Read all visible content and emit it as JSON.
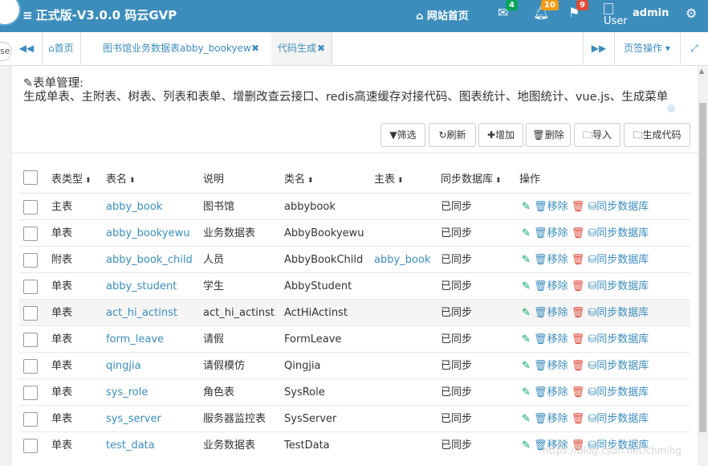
{
  "app": {
    "title": "正式版-V3.0.0 码云GVP",
    "nav_home": "网站首页",
    "mail_badge": "4",
    "bell_badge": "10",
    "flag_badge": "9",
    "user_img_alt": "User",
    "user_name": "admin"
  },
  "sidebar_stub": "se",
  "tabs": {
    "home": "首页",
    "tab1": "图书馆业务数据表abby_bookyewu",
    "tab2": "代码生成",
    "page_ops": "页签操作"
  },
  "heading": {
    "title": "表单管理:",
    "desc": "生成单表、主附表、树表、列表和表单、增删改查云接口、redis高速缓存对接代码、图表统计、地图统计、vue.js、生成菜单"
  },
  "toolbar": {
    "filter": "筛选",
    "refresh": "刷新",
    "add": "增加",
    "delete": "删除",
    "import": "导入",
    "generate": "生成代码"
  },
  "table": {
    "columns": [
      "表类型",
      "表名",
      "说明",
      "类名",
      "主表",
      "同步数据库",
      "操作"
    ],
    "action_remove": "移除",
    "action_sync": "同步数据库",
    "rows": [
      {
        "type": "主表",
        "name": "abby_book",
        "desc": "图书馆",
        "cls": "abbybook",
        "parent": "",
        "sync": "已同步"
      },
      {
        "type": "单表",
        "name": "abby_bookyewu",
        "desc": "业务数据表",
        "cls": "AbbyBookyewu",
        "parent": "",
        "sync": "已同步"
      },
      {
        "type": "附表",
        "name": "abby_book_child",
        "desc": "人员",
        "cls": "AbbyBookChild",
        "parent": "abby_book",
        "sync": "已同步"
      },
      {
        "type": "单表",
        "name": "abby_student",
        "desc": "学生",
        "cls": "AbbyStudent",
        "parent": "",
        "sync": "已同步"
      },
      {
        "type": "单表",
        "name": "act_hi_actinst",
        "desc": "act_hi_actinst",
        "cls": "ActHiActinst",
        "parent": "",
        "sync": "已同步"
      },
      {
        "type": "单表",
        "name": "form_leave",
        "desc": "请假",
        "cls": "FormLeave",
        "parent": "",
        "sync": "已同步"
      },
      {
        "type": "单表",
        "name": "qingjia",
        "desc": "请假模仿",
        "cls": "Qingjia",
        "parent": "",
        "sync": "已同步"
      },
      {
        "type": "单表",
        "name": "sys_role",
        "desc": "角色表",
        "cls": "SysRole",
        "parent": "",
        "sync": "已同步"
      },
      {
        "type": "单表",
        "name": "sys_server",
        "desc": "服务器监控表",
        "cls": "SysServer",
        "parent": "",
        "sync": "已同步"
      },
      {
        "type": "单表",
        "name": "test_data",
        "desc": "业务数据表",
        "cls": "TestData",
        "parent": "",
        "sync": "已同步"
      }
    ]
  },
  "watermark": "https://blog.csdn.net/chmlhg"
}
